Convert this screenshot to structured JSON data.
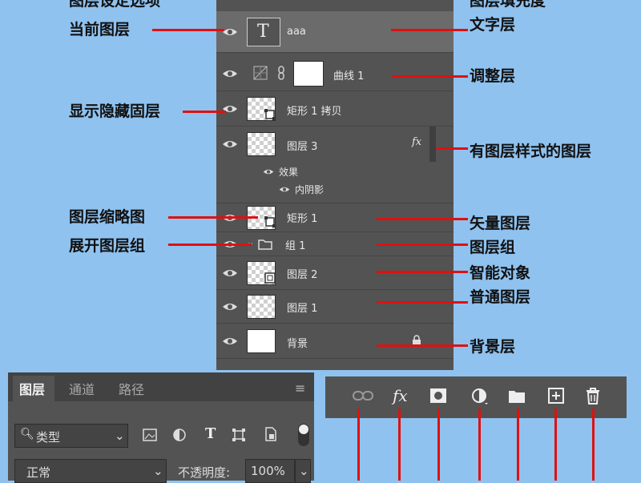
{
  "layers_panel": {
    "layers": [
      {
        "name": "aaa",
        "kind": "text",
        "thumb_glyph": "T"
      },
      {
        "name": "曲线 1",
        "kind": "adjustment"
      },
      {
        "name": "矩形 1 拷贝",
        "kind": "vector"
      },
      {
        "name": "图层 3",
        "kind": "styled",
        "fx": "fx",
        "effects_label": "效果",
        "effect_item": "内阴影"
      },
      {
        "name": "矩形 1",
        "kind": "vector"
      },
      {
        "name": "组 1",
        "kind": "group"
      },
      {
        "name": "图层 2",
        "kind": "smart"
      },
      {
        "name": "图层 1",
        "kind": "normal"
      },
      {
        "name": "背景",
        "kind": "background"
      }
    ]
  },
  "annotations": {
    "left": {
      "top_cut": "图层设定选项",
      "current_layer": "当前图层",
      "show_hide": "显示隐藏固层",
      "thumbnail": "图层缩略图",
      "expand_group": "展开图层组"
    },
    "right": {
      "top_cut": "图层填充度",
      "text_layer": "文字层",
      "adjustment_layer": "调整层",
      "styled_layer": "有图层样式的图层",
      "vector_layer": "矢量图层",
      "layer_group": "图层组",
      "smart_object": "智能对象",
      "normal_layer": "普通图层",
      "background_layer": "背景层"
    }
  },
  "bottom_panel": {
    "tabs": [
      "图层",
      "通道",
      "路径"
    ],
    "filter_value": "类型",
    "blend_mode": "正常",
    "opacity_label": "不透明度:",
    "opacity_value": "100%",
    "text_filter_glyph": "T"
  },
  "toolbar": {
    "fx_label": "fx",
    "icons": [
      "link-icon",
      "fx-icon",
      "mask-icon",
      "adjustment-icon",
      "folder-icon",
      "new-layer-icon",
      "trash-icon"
    ]
  },
  "colors": {
    "background": "#8fc2ef",
    "panel": "#535353",
    "accent_line": "#e01010"
  }
}
